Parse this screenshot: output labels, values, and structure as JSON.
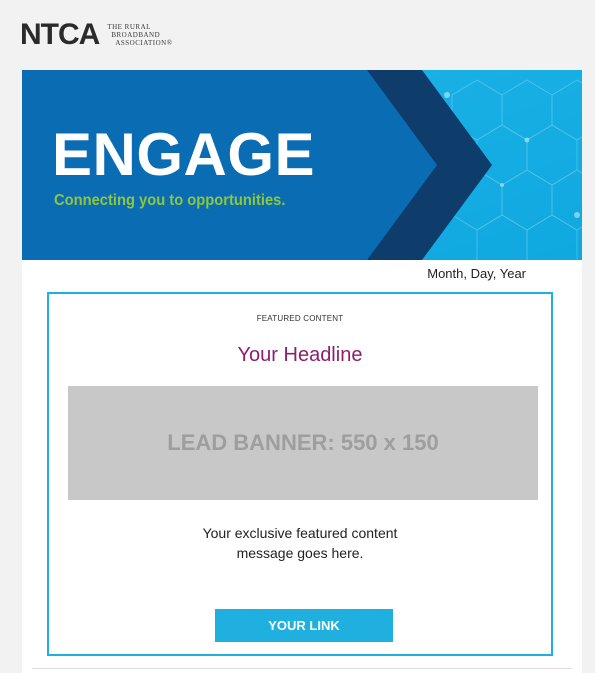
{
  "logo": {
    "mark": "NTCA",
    "tagline_lines": [
      "THE RURAL",
      "BROADBAND",
      "ASSOCIATION®"
    ]
  },
  "banner": {
    "title": "ENGAGE",
    "tagline": "Connecting you to opportunities."
  },
  "date": "Month, Day, Year",
  "featured": {
    "label": "FEATURED CONTENT",
    "headline": "Your Headline",
    "lead_banner": "LEAD BANNER: 550 x 150",
    "message_lines": [
      "Your exclusive featured content",
      "message goes here."
    ],
    "cta_label": "YOUR LINK"
  },
  "colors": {
    "accent_blue": "#1fb0e0",
    "banner_blue": "#0a6db4",
    "chevron_navy": "#0e3c6b",
    "tagline_green": "#8dc63f",
    "headline_purple": "#8b1f6e"
  }
}
